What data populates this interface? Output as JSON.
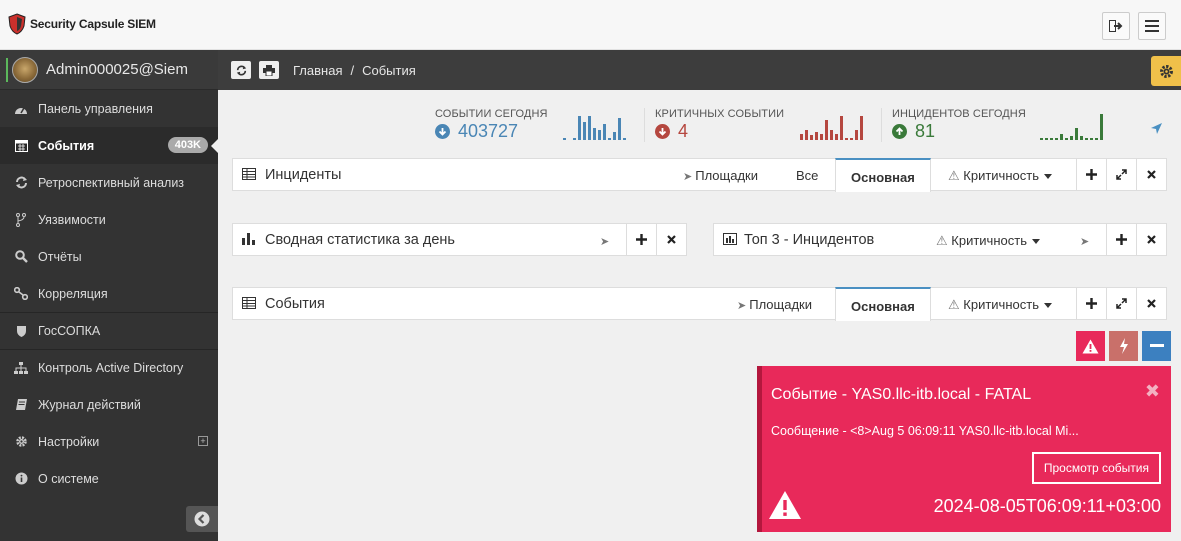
{
  "app": {
    "title": "Security Capsule SIEM"
  },
  "user": {
    "name": "Admin000025@Siem"
  },
  "sidebar": {
    "items": [
      {
        "label": "Панель управления",
        "icon": "dashboard-icon"
      },
      {
        "label": "События",
        "icon": "calendar-icon",
        "badge": "403K"
      },
      {
        "label": "Ретроспективный анализ",
        "icon": "refresh-icon"
      },
      {
        "label": "Уязвимости",
        "icon": "fork-icon"
      },
      {
        "label": "Отчёты",
        "icon": "search-icon"
      },
      {
        "label": "Корреляция",
        "icon": "link-icon"
      },
      {
        "label": "ГосСОПКА",
        "icon": "shield-icon"
      },
      {
        "label": "Контроль Active Directory",
        "icon": "sitemap-icon"
      },
      {
        "label": "Журнал действий",
        "icon": "book-icon"
      },
      {
        "label": "Настройки",
        "icon": "gear-icon"
      },
      {
        "label": "О системе",
        "icon": "info-icon"
      }
    ]
  },
  "breadcrumb": {
    "home": "Главная",
    "sep": "/",
    "current": "События"
  },
  "stats": {
    "events_today": {
      "label": "СОБЫТИИ СЕГОДНЯ",
      "value": "403727",
      "color": "#4a86b5"
    },
    "critical": {
      "label": "КРИТИЧНЫХ СОБЫТИИ",
      "value": "4",
      "color": "#b5473f"
    },
    "incidents_today": {
      "label": "ИНЦИДЕНТОВ СЕГОДНЯ",
      "value": "81",
      "color": "#3a7a3a"
    }
  },
  "panels": {
    "incidents": {
      "title": "Инциденты",
      "sites": "Площадки",
      "all": "Все",
      "tab": "Основная",
      "criticality": "Критичность"
    },
    "daily_stats": {
      "title": "Сводная статистика за день"
    },
    "top3": {
      "title": "Топ 3 - Инцидентов",
      "criticality": "Критичность"
    },
    "events": {
      "title": "События",
      "sites": "Площадки",
      "tab": "Основная",
      "criticality": "Критичность"
    }
  },
  "notification": {
    "title": "Событие - YAS0.llc-itb.local - FATAL",
    "message": "Сообщение - <8>Aug 5 06:09:11 YAS0.llc-itb.local Mi...",
    "button": "Просмотр события",
    "timestamp": "2024-08-05T06:09:11+03:00",
    "close": "✖"
  },
  "colors": {
    "accent_blue": "#4a90c2",
    "alert_red": "#e8295a",
    "gear_yellow": "#f0c04a"
  }
}
